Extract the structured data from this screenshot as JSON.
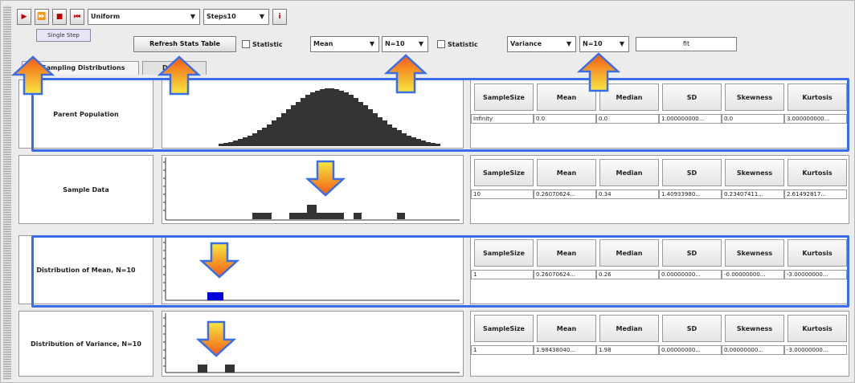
{
  "toolbar": {
    "buttons": [
      {
        "name": "step-button",
        "glyph": "▶"
      },
      {
        "name": "run-button",
        "glyph": "⏩"
      },
      {
        "name": "stop-button",
        "glyph": "■"
      },
      {
        "name": "reset-button",
        "glyph": "⏮"
      }
    ],
    "dist_select": "Uniform",
    "steps_select": "Steps10",
    "info_button": "i",
    "tooltip": "Single Step"
  },
  "options": {
    "refresh_button": "Refresh Stats Table",
    "statistic1_label": "Statistic",
    "statistic1_value": "Mean",
    "n1_value": "N=10",
    "statistic2_label": "Statistic",
    "statistic2_value": "Variance",
    "n2_value": "N=10",
    "fit_field": "fit"
  },
  "tabs": [
    {
      "label": "Sampling Distributions",
      "active": true
    },
    {
      "label": "Data",
      "active": false
    }
  ],
  "headers": [
    "SampleSize",
    "Mean",
    "Median",
    "SD",
    "Skewness",
    "Kurtosis"
  ],
  "rows": [
    {
      "label": "Parent Population",
      "values": [
        "Infinity",
        "0.0",
        "0.0",
        "1.000000000...",
        "0.0",
        "3.000000000..."
      ],
      "plot": "population"
    },
    {
      "label": "Sample Data",
      "values": [
        "10",
        "0.26070624...",
        "0.34",
        "1.40933980...",
        "0.23407411...",
        "2.61492817..."
      ],
      "plot": "sample"
    },
    {
      "label": "Distribution of Mean, N=10",
      "values": [
        "1",
        "0.26070624...",
        "0.26",
        "0.00000000...",
        "-0.00000000...",
        "-3.00000000..."
      ],
      "plot": "mean"
    },
    {
      "label": "Distribution of Variance, N=10",
      "values": [
        "1",
        "1.98438040...",
        "1.98",
        "0.00000000...",
        "0.00000000...",
        "-3.00000000..."
      ],
      "plot": "variance"
    }
  ],
  "colors": {
    "highlight": "#3a6ee8",
    "bars": "#333333",
    "mean_bar": "#0000dd",
    "arrow_top": "#f7e840",
    "arrow_bottom": "#f45a14"
  }
}
